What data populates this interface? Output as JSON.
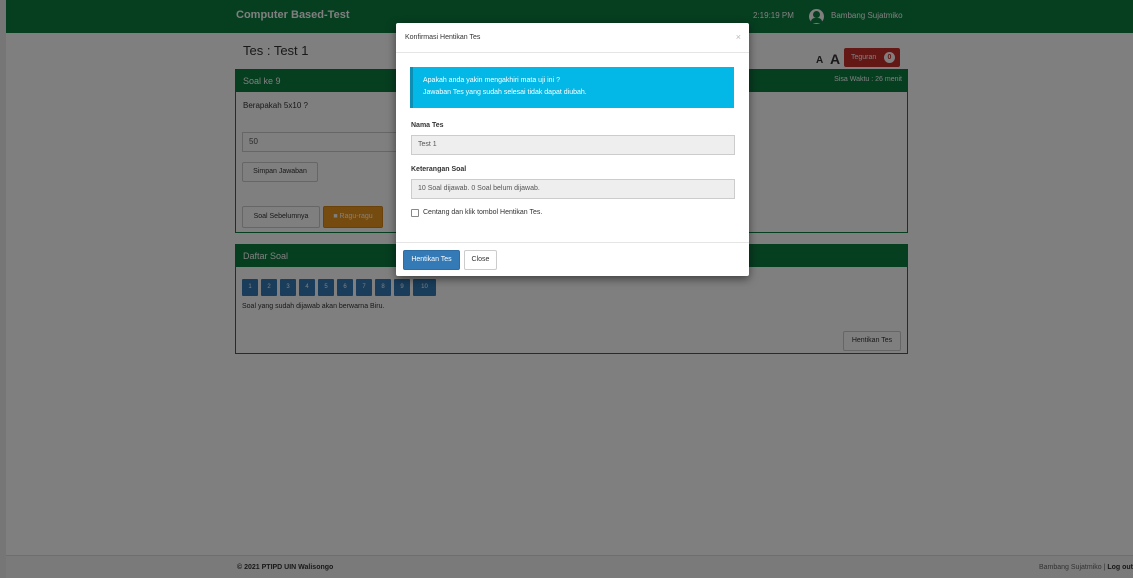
{
  "header": {
    "brand": "Computer Based-Test",
    "time": "2:19:19 PM",
    "user_name": "Bambang Sujatmiko"
  },
  "page": {
    "test_title": "Tes : Test 1",
    "font_small": "A",
    "font_large": "A",
    "teguran_label": "Teguran",
    "teguran_count": "0"
  },
  "question_panel": {
    "title": "Soal ke 9",
    "remaining_time": "Sisa Waktu : 26 menit",
    "question": "Berapakah 5x10 ?",
    "answer_value": "50",
    "save_label": "Simpan Jawaban",
    "prev_label": "Soal Sebelumnya",
    "doubt_label": "Ragu-ragu"
  },
  "list_panel": {
    "title": "Daftar Soal",
    "numbers": [
      "1",
      "2",
      "3",
      "4",
      "5",
      "6",
      "7",
      "8",
      "9",
      "10"
    ],
    "legend": "Soal yang sudah dijawab akan berwarna Biru.",
    "stop_label": "Hentikan Tes"
  },
  "footer": {
    "copyright": "© 2021 PTIPD UIN Walisongo",
    "user": "Bambang Sujatmiko",
    "separator": " | ",
    "logout": "Log out"
  },
  "modal": {
    "title": "Konfirmasi Hentikan Tes",
    "close_x": "×",
    "alert_line1": "Apakah anda yakin mengakhiri mata uji ini ?",
    "alert_line2": "Jawaban Tes yang sudah selesai tidak dapat diubah.",
    "label_nama": "Nama Tes",
    "nama_value": "Test 1",
    "label_keterangan": "Keterangan Soal",
    "keterangan_value": "10 Soal dijawab. 0 Soal belum dijawab.",
    "checkbox_label": "Centang dan klik tombol Hentikan Tes.",
    "stop_button": "Hentikan Tes",
    "close_button": "Close"
  },
  "colors": {
    "brand_green": "#0d7d40",
    "primary_blue": "#337ab7",
    "info_cyan": "#03b8e6",
    "danger_red": "#c9302c",
    "warning_orange": "#ec971f"
  }
}
